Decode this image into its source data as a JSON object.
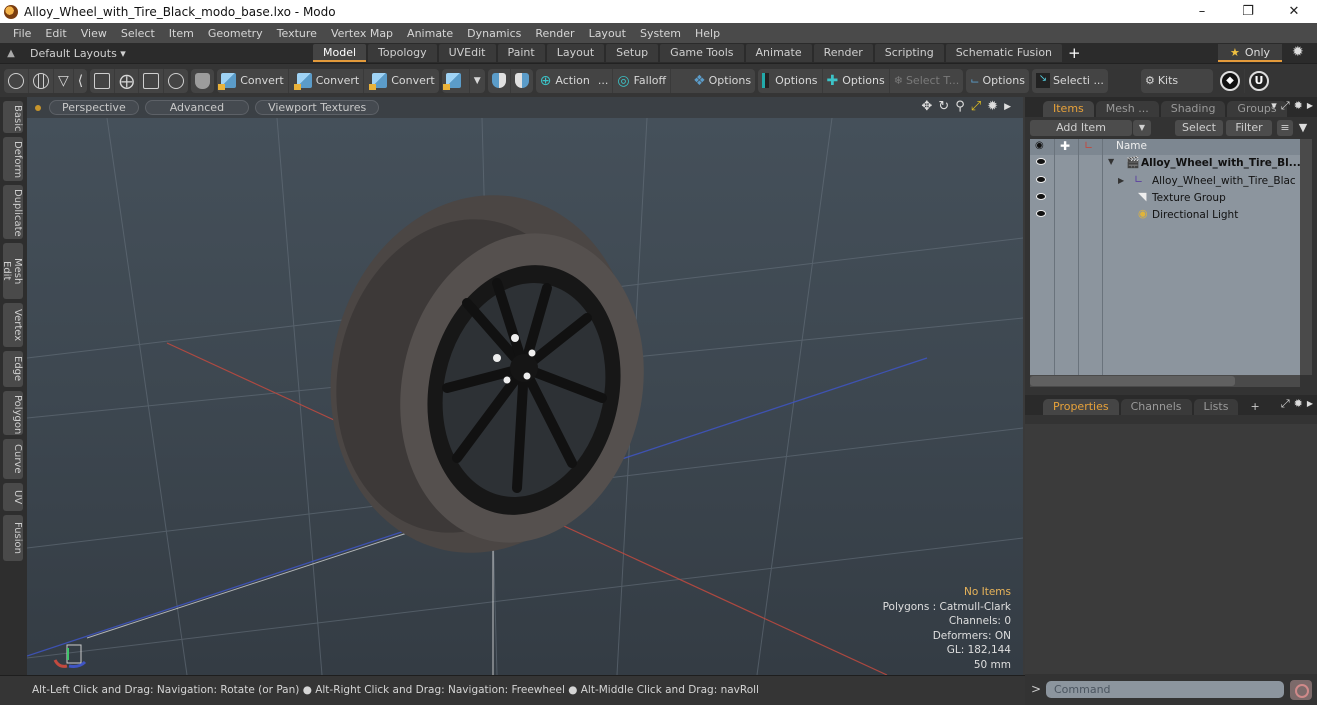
{
  "window": {
    "title": "Alloy_Wheel_with_Tire_Black_modo_base.lxo - Modo",
    "controls": [
      "minimize",
      "restore",
      "close"
    ]
  },
  "menu": [
    "File",
    "Edit",
    "View",
    "Select",
    "Item",
    "Geometry",
    "Texture",
    "Vertex Map",
    "Animate",
    "Dynamics",
    "Render",
    "Layout",
    "System",
    "Help"
  ],
  "layout_bar": {
    "default_layouts": "Default Layouts ▾",
    "tabs": [
      {
        "label": "Model",
        "active": true
      },
      {
        "label": "Topology"
      },
      {
        "label": "UVEdit"
      },
      {
        "label": "Paint"
      },
      {
        "label": "Layout"
      },
      {
        "label": "Setup"
      },
      {
        "label": "Game Tools"
      },
      {
        "label": "Animate"
      },
      {
        "label": "Render"
      },
      {
        "label": "Scripting"
      },
      {
        "label": "Schematic Fusion"
      }
    ],
    "add_tab": "+",
    "only": "Only"
  },
  "toolbar": {
    "convert1": "Convert",
    "convert2": "Convert",
    "convert3": "Convert",
    "action": "Action",
    "action_more": "...",
    "falloff": "Falloff",
    "options1": "Options",
    "options2": "Options",
    "options3": "Options",
    "select_t": "Select T...",
    "options4": "Options",
    "selecti": "Selecti ...",
    "kits": "Kits"
  },
  "viewport_header": {
    "perspective": "Perspective",
    "advanced": "Advanced",
    "viewport_textures": "Viewport Textures"
  },
  "left_tabs": [
    "Basic",
    "Deform",
    "Duplicate",
    "Mesh Edit",
    "Vertex",
    "Edge",
    "Polygon",
    "Curve",
    "UV",
    "Fusion"
  ],
  "viewport_info": {
    "selection": "No Items",
    "polygons": "Polygons : Catmull-Clark",
    "channels": "Channels: 0",
    "deformers": "Deformers: ON",
    "gl": "GL: 182,144",
    "unit": "50 mm"
  },
  "status": {
    "message": "Alt-Left Click and Drag: Navigation: Rotate (or Pan) ● Alt-Right Click and Drag: Navigation: Freewheel ● Alt-Middle Click and Drag: navRoll"
  },
  "items_panel": {
    "tabs": [
      {
        "label": "Items",
        "active": true
      },
      {
        "label": "Mesh ..."
      },
      {
        "label": "Shading"
      },
      {
        "label": "Groups"
      }
    ],
    "add_item": "Add Item",
    "select": "Select",
    "filter": "Filter",
    "column_name": "Name",
    "tree": [
      {
        "label": "Alloy_Wheel_with_Tire_Bl...",
        "type": "scene",
        "expanded": true,
        "bold": true
      },
      {
        "label": "Alloy_Wheel_with_Tire_Blac ...",
        "type": "mesh",
        "expanded": false
      },
      {
        "label": "Texture Group",
        "type": "texture-group"
      },
      {
        "label": "Directional Light",
        "type": "light"
      }
    ]
  },
  "properties_panel": {
    "tabs": [
      {
        "label": "Properties",
        "active": true
      },
      {
        "label": "Channels"
      },
      {
        "label": "Lists"
      }
    ],
    "add_tab": "+"
  },
  "command": {
    "prompt": ">",
    "placeholder": "Command"
  },
  "colors": {
    "accent": "#e39a3b",
    "x_axis": "#c24a3f",
    "y_axis": "#3fc46a",
    "z_axis": "#3f55c4"
  }
}
